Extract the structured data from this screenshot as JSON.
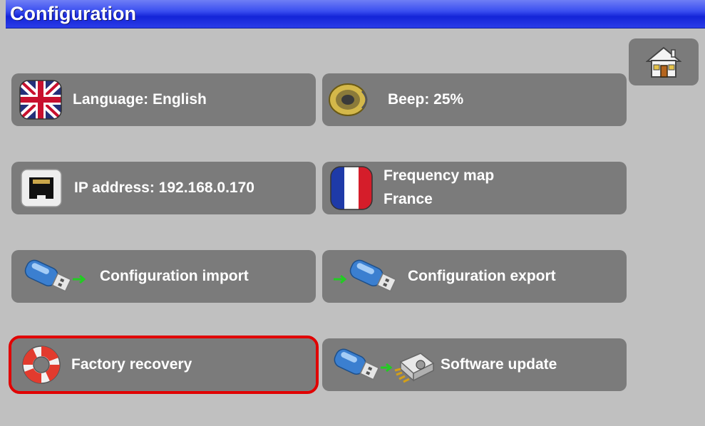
{
  "header": {
    "title": "Configuration"
  },
  "home": {
    "icon": "home-icon"
  },
  "buttons": {
    "language": {
      "label": "Language: English",
      "icon": "uk-flag-icon"
    },
    "beep": {
      "label": "Beep: 25%",
      "icon": "speaker-icon"
    },
    "ip": {
      "label": "IP address: 192.168.0.170",
      "icon": "ethernet-port-icon"
    },
    "freq": {
      "line1": "Frequency map",
      "line2": "France",
      "icon": "france-flag-icon"
    },
    "cfg_import": {
      "label": "Configuration import",
      "icon": "usb-import-icon"
    },
    "cfg_export": {
      "label": "Configuration export",
      "icon": "usb-export-icon"
    },
    "factory": {
      "label": "Factory recovery",
      "icon": "lifebuoy-icon"
    },
    "update": {
      "label": "Software update",
      "icon": "usb-chip-update-icon"
    }
  },
  "colors": {
    "selection": "#e00000",
    "button": "#7b7b7b",
    "background": "#c0c0c0",
    "title_bar": "#2a3ce8"
  }
}
